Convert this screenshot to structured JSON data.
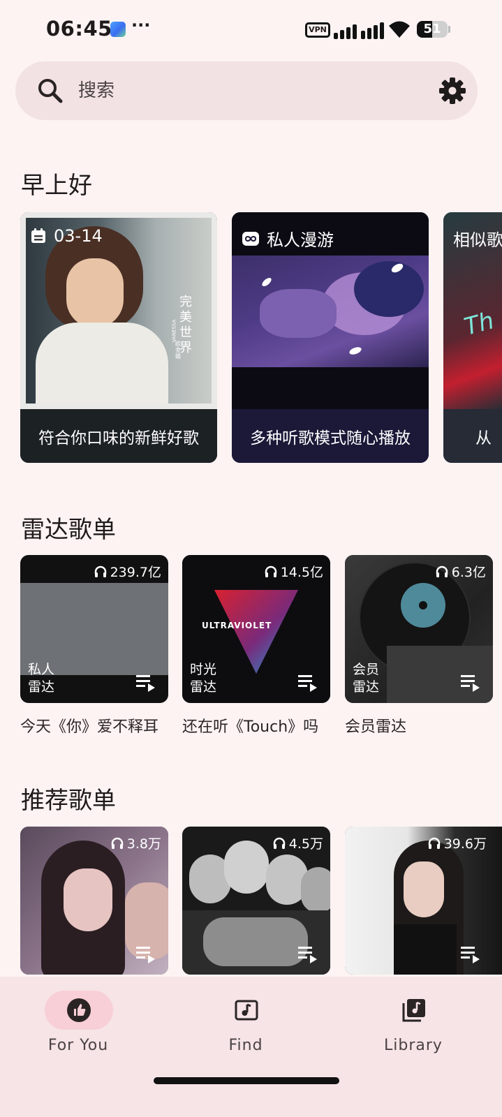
{
  "status_bar": {
    "time": "06:45",
    "dots": "···",
    "vpn_label": "VPN",
    "battery_level": 51,
    "battery_text": "51"
  },
  "search": {
    "placeholder": "搜索",
    "icon": "search-icon",
    "settings_icon": "gear-icon"
  },
  "morning": {
    "title": "早上好",
    "cards": [
      {
        "chip": "03-14",
        "chip_icon": "calendar-icon",
        "caption": "符合你口味的新鲜好歌"
      },
      {
        "chip": "私人漫游",
        "chip_icon": "infinity-icon",
        "caption": "多种听歌模式随心播放"
      },
      {
        "chip": "相似歌",
        "chip_icon": "",
        "caption": "从"
      }
    ]
  },
  "radar": {
    "title": "雷达歌单",
    "items": [
      {
        "plays": "239.7亿",
        "label_line1": "私人",
        "label_line2": "雷达",
        "title": "今天《你》爱不释耳"
      },
      {
        "plays": "14.5亿",
        "label_line1": "时光",
        "label_line2": "雷达",
        "title": "还在听《Touch》吗",
        "art_text": "ULTRAVIOLET"
      },
      {
        "plays": "6.3亿",
        "label_line1": "会员",
        "label_line2": "雷达",
        "title": "会员雷达"
      }
    ]
  },
  "recommended": {
    "title": "推荐歌单",
    "items": [
      {
        "plays": "3.8万"
      },
      {
        "plays": "4.5万"
      },
      {
        "plays": "39.6万"
      }
    ]
  },
  "album_art_text": {
    "line1": "完美",
    "line2": "世界",
    "artist": "VANESSA",
    "artist_cn": "欧金娥"
  },
  "nav": {
    "items": [
      {
        "label": "For You",
        "icon": "thumbs-up-icon",
        "active": true
      },
      {
        "label": "Find",
        "icon": "music-note-icon",
        "active": false
      },
      {
        "label": "Library",
        "icon": "music-library-icon",
        "active": false
      }
    ]
  },
  "colors": {
    "background": "#fdf3f3",
    "search_bg": "#f3e2e3",
    "nav_bg": "#f6e4e6",
    "nav_active_pill": "#f8cfd6"
  }
}
